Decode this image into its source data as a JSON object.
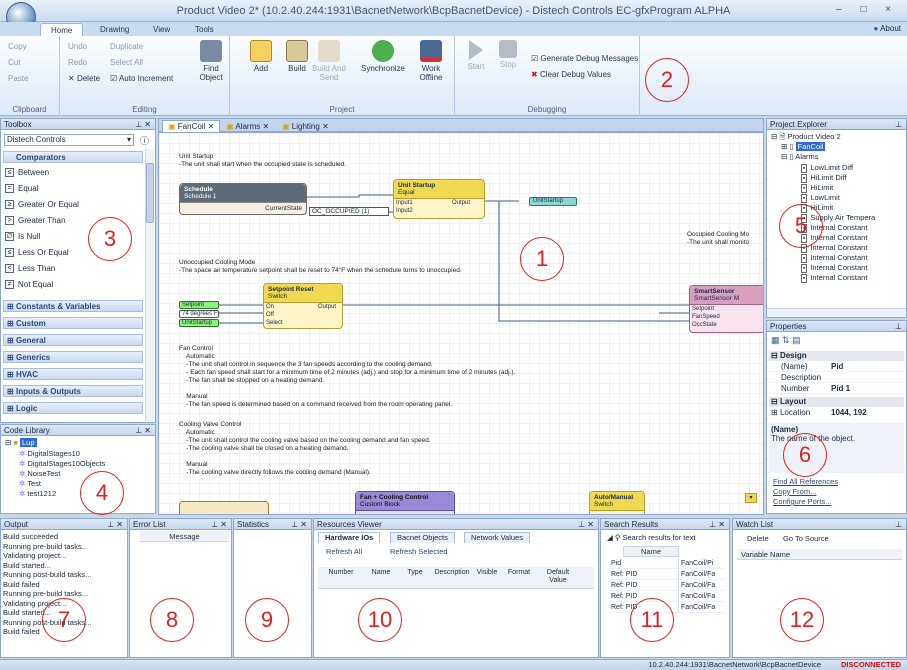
{
  "window": {
    "title": "Product Video 2* (10.2.40.244:1931\\BacnetNetwork\\BcpBacnetDevice) - Distech Controls EC-gfxProgram ALPHA",
    "controls": "–  □  ×"
  },
  "ribbon": {
    "tabs": [
      "Home",
      "Drawing",
      "View",
      "Tools"
    ],
    "about": "About",
    "clipboard": {
      "name": "Clipboard",
      "copy": "Copy",
      "cut": "Cut",
      "paste": "Paste"
    },
    "editing": {
      "name": "Editing",
      "undo": "Undo",
      "redo": "Redo",
      "delete": "Delete",
      "duplicate": "Duplicate",
      "select_all": "Select All",
      "auto_increment": "Auto Increment",
      "find_object": "Find Object"
    },
    "project": {
      "name": "Project",
      "add": "Add",
      "build": "Build",
      "build_send": "Build And Send",
      "synchronize": "Synchronize",
      "work_offline": "Work Offline"
    },
    "debugging": {
      "name": "Debugging",
      "start": "Start",
      "stop": "Stop",
      "generate": "Generate Debug Messages",
      "clear": "Clear Debug Values"
    }
  },
  "toolbox": {
    "title": "Toolbox",
    "selector": "Distech Controls",
    "comparators": "Comparators",
    "items": [
      "Between",
      "Equal",
      "Greater Or Equal",
      "Greater Than",
      "Is Null",
      "Less Or Equal",
      "Less Than",
      "Not Equal"
    ],
    "icons": [
      "≤",
      "=",
      "≥",
      ">",
      "∅",
      "≤",
      "<",
      "≠"
    ],
    "sections": [
      "Constants & Variables",
      "Custom",
      "General",
      "Generics",
      "HVAC",
      "Inputs & Outputs",
      "Logic"
    ]
  },
  "code_library": {
    "title": "Code Library",
    "root": "Lup",
    "items": [
      "DigitalStages10",
      "DigitalStages10Objects",
      "NoiseTest",
      "Test",
      "test1212"
    ]
  },
  "doc_tabs": [
    "FanCoil",
    "Alarms",
    "Lighting"
  ],
  "canvas": {
    "unit_startup_title": "Unit Startup",
    "unit_startup_desc": "-The unit shall start when the occupied state is scheduled.",
    "schedule_block": {
      "title": "Schedule",
      "sub": "Schedule 1",
      "port": "CurrentState"
    },
    "occupied_const": "OC_OCCUPIED (1)",
    "unit_startup_block": {
      "title": "Unit Startup",
      "sub": "Equal",
      "in1": "Input1",
      "in2": "Input2",
      "out": "Output"
    },
    "unit_startup_out": "UnitStartup",
    "cooling_note": "Occupied Cooling Mo\n-The unit shall monito",
    "uncocc_title": "Unoccupied Cooling Mode",
    "uncocc_desc": "-The space air temperature setpoint shall be reset to 74°F when the schedule turns to unoccupied.",
    "setpoint_block": {
      "title": "Setpoint Reset",
      "sub": "Switch",
      "on": "On",
      "off": "Off",
      "select": "Select",
      "out": "Output"
    },
    "inputs": [
      "Setpoint",
      "74 degrees F",
      "UnitStartup"
    ],
    "smart": {
      "title": "SmartSensor",
      "sub": "SmartSensor M",
      "p": [
        "Setpoint",
        "FanSpeed",
        "OccState"
      ]
    },
    "fan_text": "Fan Control\n    Automatic\n    -The unit shall control in sequence the 3 fan speeds according to the cooling demand.\n    - Each fan speed shall start for a minimum time of 2 minutes (adj.) and stop for a minimum time of 2 minutes (adj.).\n    -The fan shall be stopped on a heating demand.\n\n    Manual\n    -The fan speed is determined based on a command received from the room operating panel.",
    "cool_text": "Cooling Valve Control\n    Automatic\n    -The unit shall control the cooling valve based on the cooling demand and fan speed.\n    -The cooling valve shall be closed on a heating demand.\n\n    Manual\n    -The cooling valve directly follows the cooling demand (Manual).",
    "bottom_blocks": [
      "Fan + Cooling Control",
      "Custom Block",
      "Auto/Manual",
      "Switch"
    ]
  },
  "project_explorer": {
    "title": "Project Explorer",
    "root": "Product Video 2",
    "fancoil": "FanCoil",
    "alarms": "Alarms",
    "items": [
      "LowLimit Diff",
      "HiLimit Diff",
      "HiLimit",
      "LowLimit",
      "HiLimit",
      "Supply Air Tempera",
      "Internal Constant",
      "Internal Constant",
      "Internal Constant",
      "Internal Constant",
      "Internal Constant",
      "Internal Constant"
    ]
  },
  "properties": {
    "title": "Properties",
    "design": "Design",
    "rows": [
      [
        "(Name)",
        "Pid"
      ],
      [
        "Description",
        ""
      ],
      [
        "Number",
        "Pid 1"
      ]
    ],
    "layout": "Layout",
    "location": [
      "Location",
      "1044, 192"
    ],
    "help_title": "(Name)",
    "help_text": "The name of the object.",
    "links": [
      "Find All References",
      "Copy From...",
      "Configure Ports..."
    ]
  },
  "output": {
    "title": "Output",
    "lines": [
      "Build succeeded",
      "Running pre-build tasks...",
      "Validating project...",
      "Build started...",
      "Running post-build tasks...",
      "Build failed",
      "Running pre-build tasks...",
      "Validating project...",
      "Build started...",
      "Running post-build tasks...",
      "Build failed"
    ]
  },
  "error_list": {
    "title": "Error List",
    "col": "Message"
  },
  "statistics": {
    "title": "Statistics"
  },
  "resources": {
    "title": "Resources Viewer",
    "tabs": [
      "Hardware IOs",
      "Bacnet Objects",
      "Network Values"
    ],
    "refresh_all": "Refresh All",
    "refresh_selected": "Refresh Selected",
    "cols": [
      "Number",
      "Name",
      "Type",
      "Description",
      "Visible",
      "Format",
      "Default Value"
    ]
  },
  "search": {
    "title": "Search Results",
    "query": "Search results for text",
    "col": "Name",
    "rows": [
      [
        "Pid",
        "FanCoil/Pi"
      ],
      [
        "Ref: PID",
        "FanCoil/Fa"
      ],
      [
        "Ref: PID",
        "FanCoil/Fa"
      ],
      [
        "Ref: PID",
        "FanCoil/Fa"
      ],
      [
        "Ref: PID",
        "FanCoil/Fa"
      ]
    ]
  },
  "watch": {
    "title": "Watch List",
    "delete": "Delete",
    "goto": "Go To Source",
    "col": "Variable Name"
  },
  "status": {
    "path": "10.2.40.244:1931\\BacnetNetwork\\BcpBacnetDevice",
    "state": "DISCONNECTED",
    "state_color": "#d01010"
  },
  "annotations": [
    "1",
    "2",
    "3",
    "4",
    "5",
    "6",
    "7",
    "8",
    "9",
    "10",
    "11",
    "12"
  ]
}
